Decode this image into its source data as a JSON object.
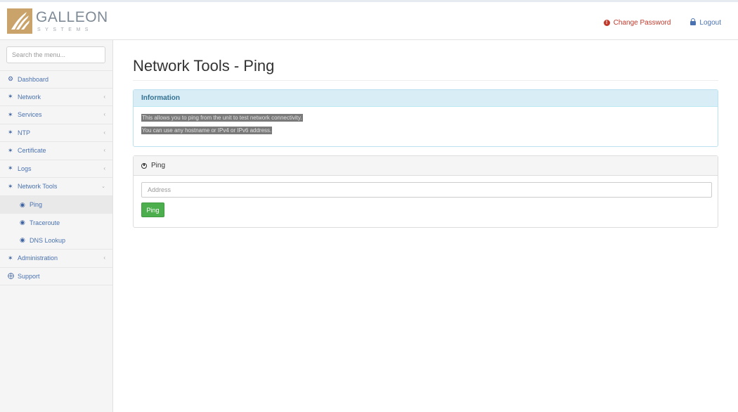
{
  "brand": {
    "name": "GALLEON",
    "tagline": "SYSTEMS",
    "accent": "#c9a36a"
  },
  "header": {
    "change_password": "Change Password",
    "logout": "Logout",
    "change_password_color": "#c0392b",
    "logout_color": "#4a72b0"
  },
  "sidebar": {
    "search_placeholder": "Search the menu...",
    "items": [
      {
        "label": "Dashboard",
        "icon": "dashboard-icon"
      },
      {
        "label": "Network",
        "icon": "wrench-icon",
        "expandable": true
      },
      {
        "label": "Services",
        "icon": "wrench-icon",
        "expandable": true
      },
      {
        "label": "NTP",
        "icon": "wrench-icon",
        "expandable": true
      },
      {
        "label": "Certificate",
        "icon": "wrench-icon",
        "expandable": true
      },
      {
        "label": "Logs",
        "icon": "wrench-icon",
        "expandable": true
      },
      {
        "label": "Network Tools",
        "icon": "wrench-icon",
        "expanded": true
      },
      {
        "label": "Ping",
        "icon": "globe-icon",
        "sub": true,
        "active": true
      },
      {
        "label": "Traceroute",
        "icon": "globe-icon",
        "sub": true
      },
      {
        "label": "DNS Lookup",
        "icon": "globe-icon",
        "sub": true
      },
      {
        "label": "Administration",
        "icon": "wrench-icon",
        "expandable": true
      },
      {
        "label": "Support",
        "icon": "support-icon"
      }
    ]
  },
  "main": {
    "title": "Network Tools - Ping",
    "info": {
      "heading": "Information",
      "lines": [
        "This allows you to ping from the unit to test network connectivity.",
        "You can use any hostname or IPv4 or IPv6 address."
      ]
    },
    "ping": {
      "heading": "Ping",
      "address_placeholder": "Address",
      "address_value": "",
      "button_label": "Ping",
      "button_color": "#4cae4c"
    }
  }
}
